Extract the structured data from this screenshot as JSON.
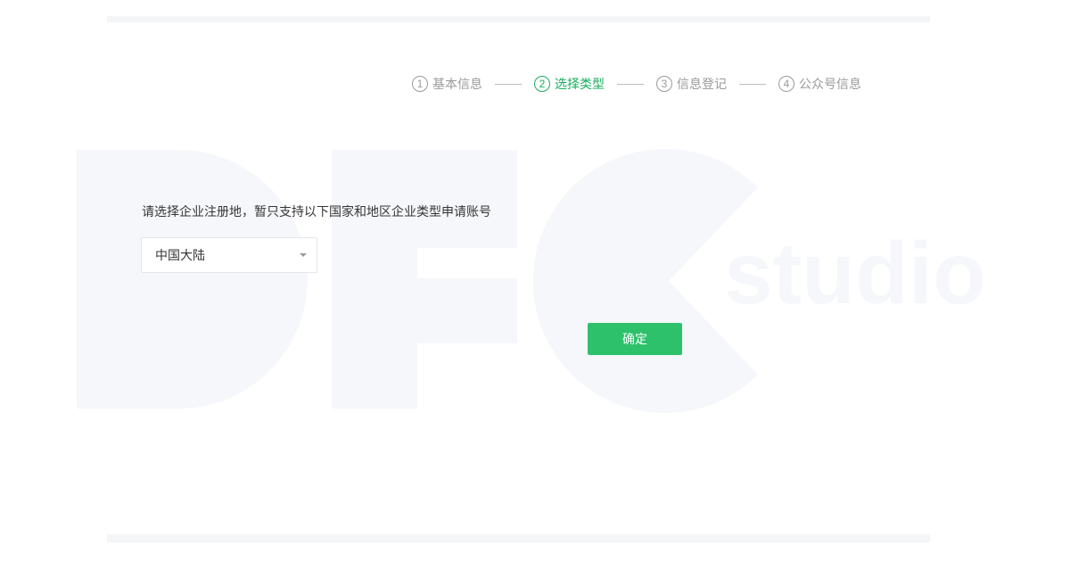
{
  "stepper": {
    "steps": [
      {
        "num": "1",
        "label": "基本信息",
        "state": "done"
      },
      {
        "num": "2",
        "label": "选择类型",
        "state": "active"
      },
      {
        "num": "3",
        "label": "信息登记",
        "state": "pending"
      },
      {
        "num": "4",
        "label": "公众号信息",
        "state": "pending"
      }
    ],
    "active_color": "#1aad5f",
    "inactive_color": "#9a9a9a"
  },
  "form": {
    "prompt": "请选择企业注册地，暂只支持以下国家和地区企业类型申请账号",
    "region_select": {
      "selected": "中国大陆"
    },
    "confirm_label": "确定",
    "confirm_color": "#2ec16c"
  },
  "watermark": {
    "text": "studio",
    "color": "#f5f7fa"
  }
}
